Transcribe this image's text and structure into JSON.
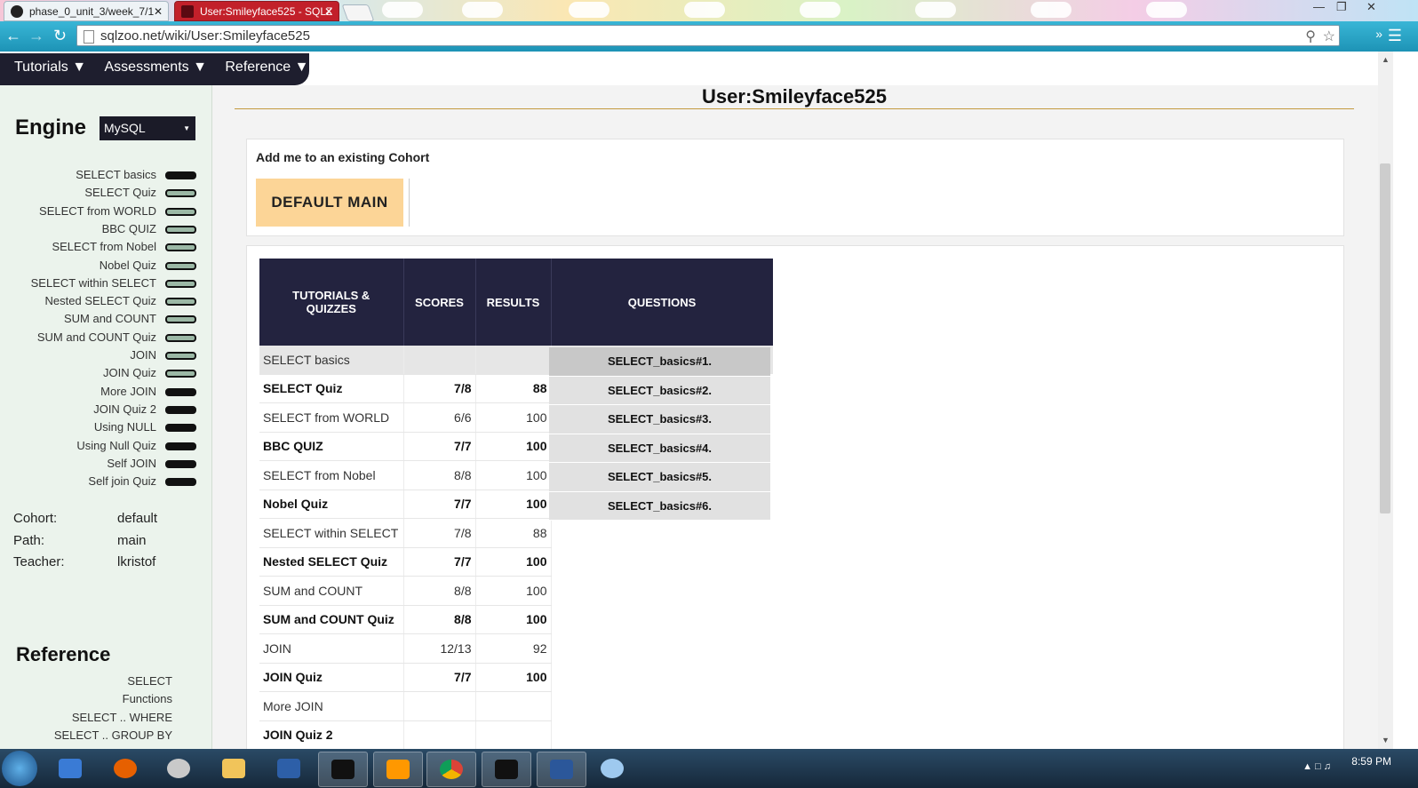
{
  "browser": {
    "tabs": [
      {
        "label": "phase_0_unit_3/week_7/1",
        "close": "✕"
      },
      {
        "label": "User:Smileyface525 - SQLZ",
        "close": "✕"
      }
    ],
    "url": "sqlzoo.net/wiki/User:Smileyface525",
    "window_controls": [
      "—",
      "❐",
      "✕"
    ]
  },
  "site_nav": {
    "items": [
      "Tutorials ▼",
      "Assessments ▼",
      "Reference ▼"
    ]
  },
  "sidebar": {
    "engine_label": "Engine",
    "engine_value": "MySQL",
    "tutorials": [
      {
        "label": "SELECT basics",
        "progress": "full"
      },
      {
        "label": "SELECT Quiz",
        "progress": "partial"
      },
      {
        "label": "SELECT from WORLD",
        "progress": "partial"
      },
      {
        "label": "BBC QUIZ",
        "progress": "partial"
      },
      {
        "label": "SELECT from Nobel",
        "progress": "partial"
      },
      {
        "label": "Nobel Quiz",
        "progress": "partial"
      },
      {
        "label": "SELECT within SELECT",
        "progress": "partial"
      },
      {
        "label": "Nested SELECT Quiz",
        "progress": "partial"
      },
      {
        "label": "SUM and COUNT",
        "progress": "partial"
      },
      {
        "label": "SUM and COUNT Quiz",
        "progress": "partial"
      },
      {
        "label": "JOIN",
        "progress": "partial"
      },
      {
        "label": "JOIN Quiz",
        "progress": "partial"
      },
      {
        "label": "More JOIN",
        "progress": "full"
      },
      {
        "label": "JOIN Quiz 2",
        "progress": "full"
      },
      {
        "label": "Using NULL",
        "progress": "full"
      },
      {
        "label": "Using Null Quiz",
        "progress": "full"
      },
      {
        "label": "Self JOIN",
        "progress": "full"
      },
      {
        "label": "Self join Quiz",
        "progress": "full"
      }
    ],
    "info": [
      {
        "key": "Cohort:",
        "value": "default"
      },
      {
        "key": "Path:",
        "value": "main"
      },
      {
        "key": "Teacher:",
        "value": "lkristof"
      }
    ],
    "reference_title": "Reference",
    "reference_items": [
      "SELECT",
      "Functions",
      "SELECT .. WHERE",
      "SELECT .. GROUP BY"
    ]
  },
  "main": {
    "title": "User:Smileyface525",
    "cohort_label": "Add me to an existing Cohort",
    "cohort_button": "DEFAULT MAIN",
    "table_headers": [
      "TUTORIALS & QUIZZES",
      "SCORES",
      "RESULTS",
      "QUESTIONS"
    ],
    "rows": [
      {
        "name": "SELECT basics",
        "score": "",
        "result": "",
        "bold": false,
        "selected": true
      },
      {
        "name": "SELECT Quiz",
        "score": "7/8",
        "result": "88",
        "bold": true
      },
      {
        "name": "SELECT from WORLD",
        "score": "6/6",
        "result": "100",
        "bold": false
      },
      {
        "name": "BBC QUIZ",
        "score": "7/7",
        "result": "100",
        "bold": true
      },
      {
        "name": "SELECT from Nobel",
        "score": "8/8",
        "result": "100",
        "bold": false
      },
      {
        "name": "Nobel Quiz",
        "score": "7/7",
        "result": "100",
        "bold": true
      },
      {
        "name": "SELECT within SELECT",
        "score": "7/8",
        "result": "88",
        "bold": false
      },
      {
        "name": "Nested SELECT Quiz",
        "score": "7/7",
        "result": "100",
        "bold": true
      },
      {
        "name": "SUM and COUNT",
        "score": "8/8",
        "result": "100",
        "bold": false
      },
      {
        "name": "SUM and COUNT Quiz",
        "score": "8/8",
        "result": "100",
        "bold": true
      },
      {
        "name": "JOIN",
        "score": "12/13",
        "result": "92",
        "bold": false
      },
      {
        "name": "JOIN Quiz",
        "score": "7/7",
        "result": "100",
        "bold": true
      },
      {
        "name": "More JOIN",
        "score": "",
        "result": "",
        "bold": false
      },
      {
        "name": "JOIN Quiz 2",
        "score": "",
        "result": "",
        "bold": true
      }
    ],
    "questions": [
      "SELECT_basics#1.",
      "SELECT_basics#2.",
      "SELECT_basics#3.",
      "SELECT_basics#4.",
      "SELECT_basics#5.",
      "SELECT_basics#6."
    ]
  },
  "taskbar": {
    "time": "8:59 PM"
  },
  "colors": {
    "nav_bg": "#1e1e2e",
    "header_bg": "#23233f",
    "cohort_button": "#fcd597",
    "sidebar_bg": "#ebf3ec",
    "title_rule": "#c49a3f"
  }
}
